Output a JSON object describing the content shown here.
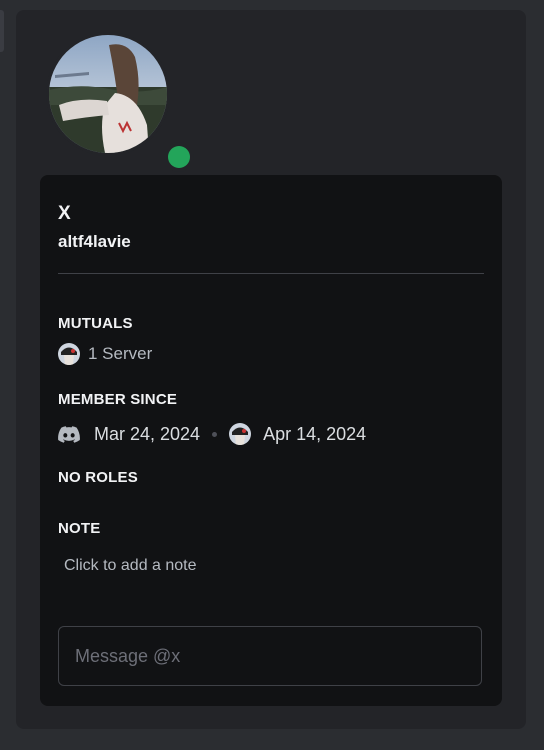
{
  "profile": {
    "display_name": "X",
    "username": "altf4lavie",
    "status": "online",
    "status_color": "#23a55a"
  },
  "mutuals": {
    "title": "MUTUALS",
    "servers_label": "1 Server"
  },
  "member_since": {
    "title": "MEMBER SINCE",
    "discord_icon": "discord-logo-icon",
    "discord_date": "Mar 24, 2024",
    "server_date": "Apr 14, 2024"
  },
  "roles": {
    "title": "NO ROLES"
  },
  "note": {
    "title": "NOTE",
    "placeholder": "Click to add a note"
  },
  "message": {
    "placeholder": "Message @x"
  },
  "colors": {
    "background": "#2b2d31",
    "card": "#232428",
    "inner_card": "#111214",
    "online_green": "#23a55a"
  }
}
